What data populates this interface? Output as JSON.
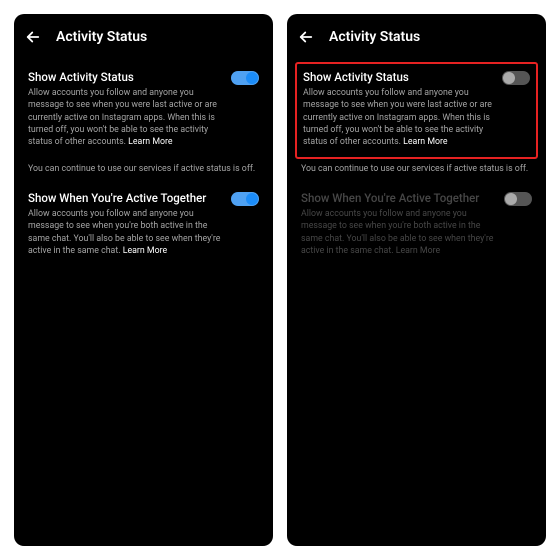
{
  "header": {
    "title": "Activity Status"
  },
  "screens": {
    "left": {
      "activity": {
        "title": "Show Activity Status",
        "desc": "Allow accounts you follow and anyone you message to see when you were last active or are currently active on Instagram apps. When this is turned off, you won't be able to see the activity status of other accounts.",
        "learn": "Learn More",
        "enabled": true
      },
      "note": "You can continue to use our services if active status is off.",
      "together": {
        "title": "Show When You're Active Together",
        "desc": "Allow accounts you follow and anyone you message to see when you're both active in the same chat. You'll also be able to see when they're active in the same chat.",
        "learn": "Learn More",
        "enabled": true
      }
    },
    "right": {
      "activity": {
        "title": "Show Activity Status",
        "desc": "Allow accounts you follow and anyone you message to see when you were last active or are currently active on Instagram apps. When this is turned off, you won't be able to see the activity status of other accounts.",
        "learn": "Learn More",
        "enabled": false
      },
      "note": "You can continue to use our services if active status is off.",
      "together": {
        "title": "Show When You're Active Together",
        "desc": "Allow accounts you follow and anyone you message to see when you're both active in the same chat. You'll also be able to see when they're active in the same chat.",
        "learn": "Learn More",
        "enabled": false,
        "disabled_ui": true
      }
    }
  }
}
